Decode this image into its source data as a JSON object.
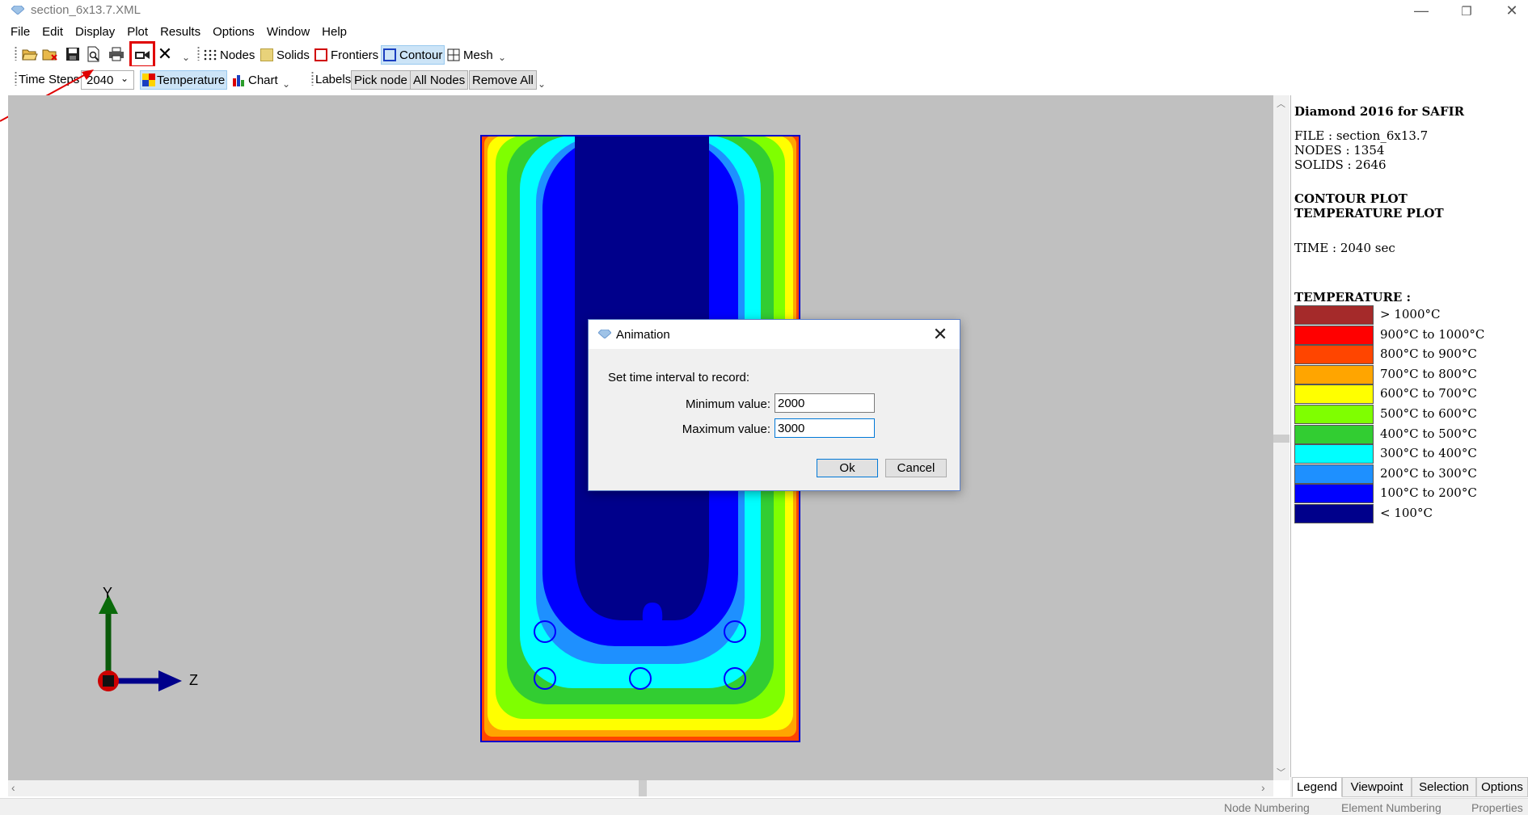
{
  "window": {
    "title": "section_6x13.7.XML",
    "minimize": "—",
    "restore": "❐",
    "close": "✕"
  },
  "menu": [
    "File",
    "Edit",
    "Display",
    "Plot",
    "Results",
    "Options",
    "Window",
    "Help"
  ],
  "toolbar1": {
    "icons": [
      "open-folder-icon",
      "open-remove-icon",
      "save-icon",
      "print-preview-icon",
      "print-icon",
      "record-animation-icon",
      "close-x-icon"
    ],
    "nodes_label": "Nodes",
    "solids_label": "Solids",
    "frontiers_label": "Frontiers",
    "contour_label": "Contour",
    "mesh_label": "Mesh"
  },
  "toolbar2": {
    "time_steps_label": "Time Steps",
    "time_steps_value": "2040",
    "temperature_label": "Temperature",
    "chart_label": "Chart",
    "labels_label": "Labels",
    "pick_node_label": "Pick node",
    "all_nodes_label": "All Nodes",
    "remove_all_label": "Remove All"
  },
  "axes": {
    "y": "Y",
    "z": "Z"
  },
  "panel": {
    "app": "Diamond 2016 for SAFIR",
    "file": "FILE : section_6x13.7",
    "nodes": "NODES : 1354",
    "solids": "SOLIDS : 2646",
    "plot1": "CONTOUR PLOT",
    "plot2": "TEMPERATURE PLOT",
    "time": "TIME : 2040 sec",
    "legend_title": "TEMPERATURE :",
    "legend": [
      {
        "label": "> 1000°C",
        "color": "#a52a2a"
      },
      {
        "label": "900°C to 1000°C",
        "color": "#ff0000"
      },
      {
        "label": "800°C to 900°C",
        "color": "#ff4500"
      },
      {
        "label": "700°C to 800°C",
        "color": "#ffa500"
      },
      {
        "label": "600°C to 700°C",
        "color": "#ffff00"
      },
      {
        "label": "500°C to 600°C",
        "color": "#7fff00"
      },
      {
        "label": "400°C to 500°C",
        "color": "#32cd32"
      },
      {
        "label": "300°C to 400°C",
        "color": "#00ffff"
      },
      {
        "label": "200°C to 300°C",
        "color": "#1e90ff"
      },
      {
        "label": "100°C to 200°C",
        "color": "#0000ff"
      },
      {
        "label": "< 100°C",
        "color": "#00008b"
      }
    ],
    "tabs": [
      "Legend",
      "Viewpoint",
      "Selection",
      "Options"
    ]
  },
  "statusbar": [
    "Node Numbering",
    "Element Numbering",
    "Properties"
  ],
  "dialog": {
    "title": "Animation",
    "prompt": "Set time interval to record:",
    "min_label": "Minimum value:",
    "min_value": "2000",
    "max_label": "Maximum value:",
    "max_value": "3000",
    "ok": "Ok",
    "cancel": "Cancel"
  }
}
